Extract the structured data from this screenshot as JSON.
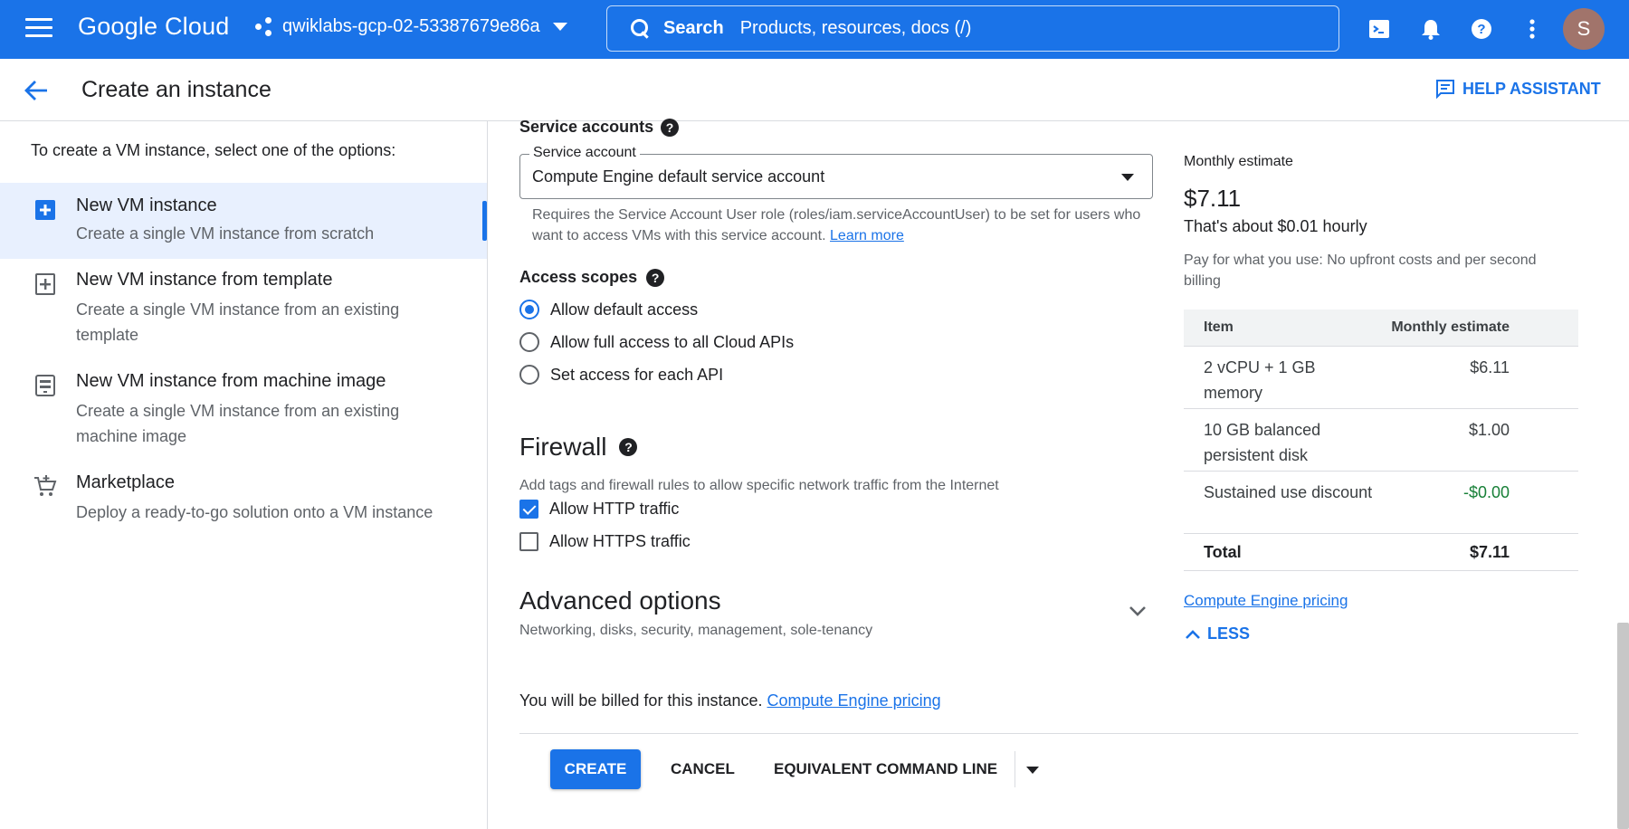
{
  "topbar": {
    "logo": "Google Cloud",
    "project": "qwiklabs-gcp-02-53387679e86a",
    "search_label": "Search",
    "search_placeholder": "Products, resources, docs (/)",
    "avatar_initial": "S",
    "icons": [
      "menu-icon",
      "terminal-icon",
      "bell-icon",
      "help-icon",
      "more-vert-icon"
    ]
  },
  "page": {
    "title": "Create an instance",
    "help_assistant": "HELP ASSISTANT"
  },
  "left": {
    "intro": "To create a VM instance, select one of the options:",
    "options": [
      {
        "title": "New VM instance",
        "desc": "Create a single VM instance from scratch",
        "icon": "add-box-icon",
        "selected": true
      },
      {
        "title": "New VM instance from template",
        "desc": "Create a single VM instance from an existing template",
        "icon": "add-template-icon",
        "selected": false
      },
      {
        "title": "New VM instance from machine image",
        "desc": "Create a single VM instance from an existing machine image",
        "icon": "machine-image-icon",
        "selected": false
      },
      {
        "title": "Marketplace",
        "desc": "Deploy a ready-to-go solution onto a VM instance",
        "icon": "cart-icon",
        "selected": false
      }
    ]
  },
  "main": {
    "service_accounts_title": "Service accounts",
    "service_account_label": "Service account",
    "service_account_value": "Compute Engine default service account",
    "service_account_hint": "Requires the Service Account User role (roles/iam.serviceAccountUser) to be set for users who want to access VMs with this service account.",
    "learn_more": "Learn more",
    "access_scopes_title": "Access scopes",
    "access_scopes": [
      {
        "label": "Allow default access",
        "selected": true
      },
      {
        "label": "Allow full access to all Cloud APIs",
        "selected": false
      },
      {
        "label": "Set access for each API",
        "selected": false
      }
    ],
    "firewall_title": "Firewall",
    "firewall_desc": "Add tags and firewall rules to allow specific network traffic from the Internet",
    "firewall_options": [
      {
        "label": "Allow HTTP traffic",
        "checked": true
      },
      {
        "label": "Allow HTTPS traffic",
        "checked": false
      }
    ],
    "advanced_title": "Advanced options",
    "advanced_sub": "Networking, disks, security, management, sole-tenancy",
    "billed_text": "You will be billed for this instance.",
    "billed_link": "Compute Engine pricing"
  },
  "actions": {
    "create": "CREATE",
    "cancel": "CANCEL",
    "command_line": "EQUIVALENT COMMAND LINE"
  },
  "estimate": {
    "label": "Monthly estimate",
    "value": "$7.11",
    "hourly": "That's about $0.01 hourly",
    "note": "Pay for what you use: No upfront costs and per second billing",
    "table": {
      "headers": [
        "Item",
        "Monthly estimate"
      ],
      "rows": [
        {
          "item": "2 vCPU + 1 GB memory",
          "cost": "$6.11"
        },
        {
          "item": "10 GB balanced persistent disk",
          "cost": "$1.00"
        },
        {
          "item": "Sustained use discount",
          "cost": "-$0.00"
        }
      ],
      "total_label": "Total",
      "total_value": "$7.11"
    },
    "pricing_link": "Compute Engine pricing",
    "less": "LESS"
  },
  "colors": {
    "brand": "#1a73e8",
    "selected_bg": "#e8f0fe",
    "discount": "#188038"
  }
}
